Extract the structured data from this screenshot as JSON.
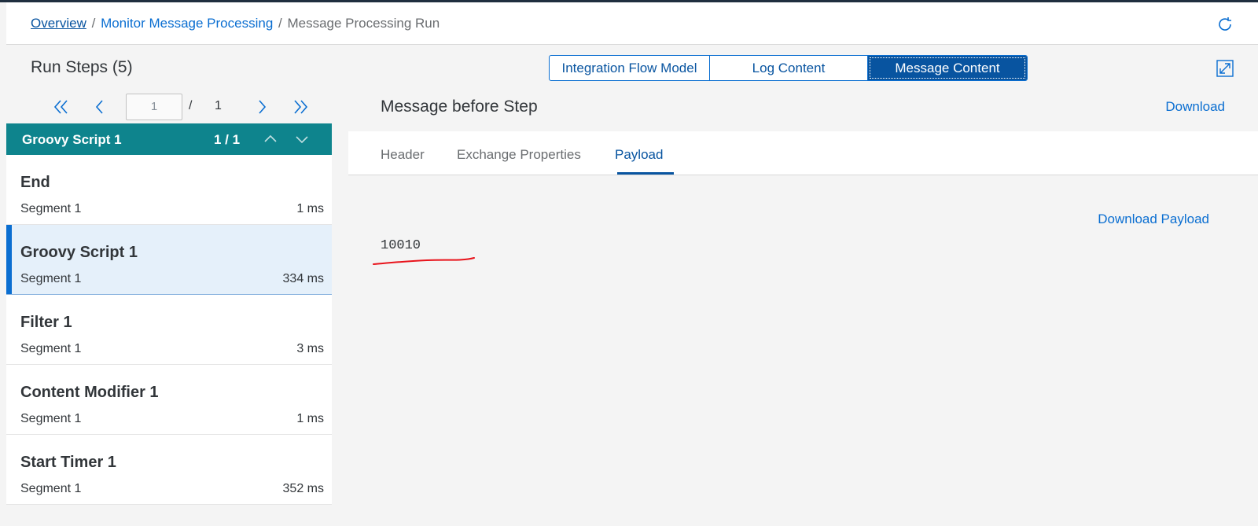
{
  "breadcrumb": {
    "overview": "Overview",
    "monitor": "Monitor Message Processing",
    "current": "Message Processing Run",
    "separator": "/"
  },
  "left": {
    "title": "Run Steps (5)",
    "pager": {
      "input_value": "1",
      "slash": "/",
      "total": "1"
    },
    "group": {
      "name": "Groovy Script 1",
      "count": "1 / 1"
    },
    "steps": [
      {
        "name": "End",
        "segment": "Segment 1",
        "duration": "1 ms"
      },
      {
        "name": "Groovy Script 1",
        "segment": "Segment 1",
        "duration": "334 ms"
      },
      {
        "name": "Filter 1",
        "segment": "Segment 1",
        "duration": "3 ms"
      },
      {
        "name": "Content Modifier 1",
        "segment": "Segment 1",
        "duration": "1 ms"
      },
      {
        "name": "Start Timer 1",
        "segment": "Segment 1",
        "duration": "352 ms"
      }
    ]
  },
  "segments": [
    "Integration Flow Model",
    "Log Content",
    "Message Content"
  ],
  "content": {
    "title": "Message before Step",
    "download": "Download",
    "tabs": [
      "Header",
      "Exchange Properties",
      "Payload"
    ],
    "download_payload": "Download Payload",
    "payload": "10010"
  },
  "colors": {
    "accent": "#0a6ed1",
    "group_bar": "#0e848d",
    "selected_bg": "#e5f0fa",
    "annotation": "#e8131b"
  },
  "icons": {
    "refresh": "refresh-icon",
    "fullscreen": "fullscreen-icon",
    "first": "double-chevron-left-icon",
    "prev": "chevron-left-icon",
    "next": "chevron-right-icon",
    "last": "double-chevron-right-icon",
    "up": "chevron-up-icon",
    "down": "chevron-down-icon"
  }
}
